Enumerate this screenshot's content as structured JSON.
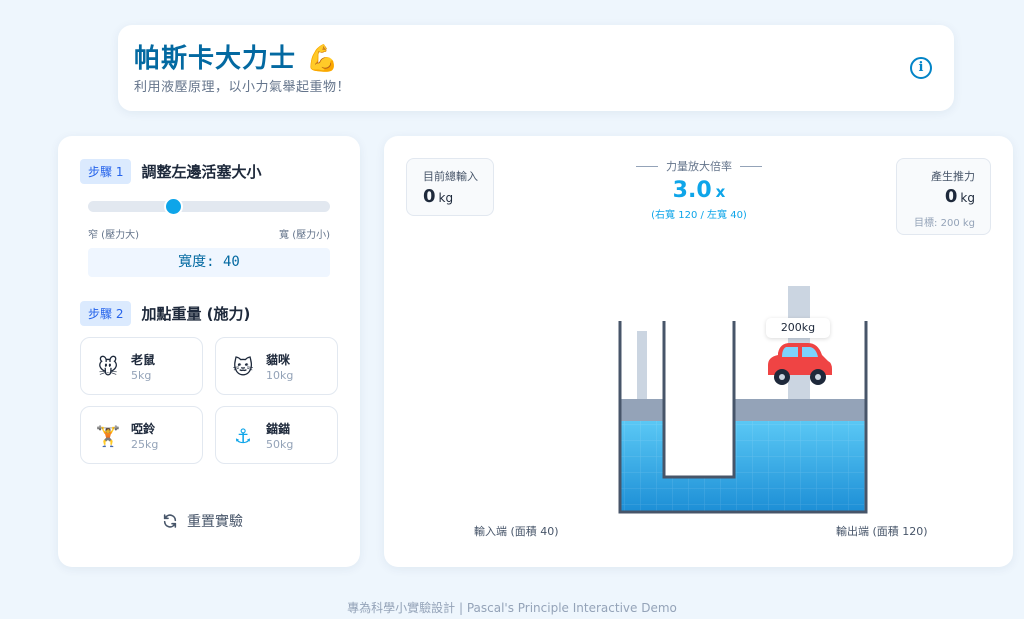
{
  "header": {
    "title": "帕斯卡大力士 💪",
    "subtitle": "利用液壓原理，以小力氣舉起重物！",
    "info_icon": "info-circle-icon"
  },
  "step1": {
    "badge": "步驟 1",
    "title": "調整左邊活塞大小",
    "slider_min_label": "窄 (壓力大)",
    "slider_max_label": "寬 (壓力小)",
    "slider_level": 0.35,
    "width_display": "寬度: 40"
  },
  "step2": {
    "badge": "步驟 2",
    "title": "加點重量 (施力)",
    "weights": [
      {
        "icon": "🐭",
        "name": "老鼠",
        "mass": "5kg"
      },
      {
        "icon": "🐱",
        "name": "貓咪",
        "mass": "10kg"
      },
      {
        "icon": "🏋️",
        "name": "啞鈴",
        "mass": "25kg"
      },
      {
        "icon": "⚓",
        "name": "錨錨",
        "mass": "50kg"
      }
    ]
  },
  "reset_label": "重置實驗",
  "stats": {
    "input_label": "目前總輸入",
    "input_value": "0",
    "input_unit": "kg",
    "ratio_label": "力量放大倍率",
    "ratio_value": "3.0",
    "ratio_x": "x",
    "ratio_detail": "(右寬 120 / 左寬 40)",
    "output_label": "產生推力",
    "output_value": "0",
    "output_unit": "kg",
    "output_target": "目標: 200 kg"
  },
  "tank": {
    "input_label": "輸入端 (面積 40)",
    "output_label": "輸出端 (面積 120)",
    "car_label": "200kg",
    "car_icon": "🚗",
    "water_color": "#38bdf8",
    "piston_color": "#94a3b8"
  },
  "footer": "專為科學小實驗設計 | Pascal's Principle Interactive Demo"
}
